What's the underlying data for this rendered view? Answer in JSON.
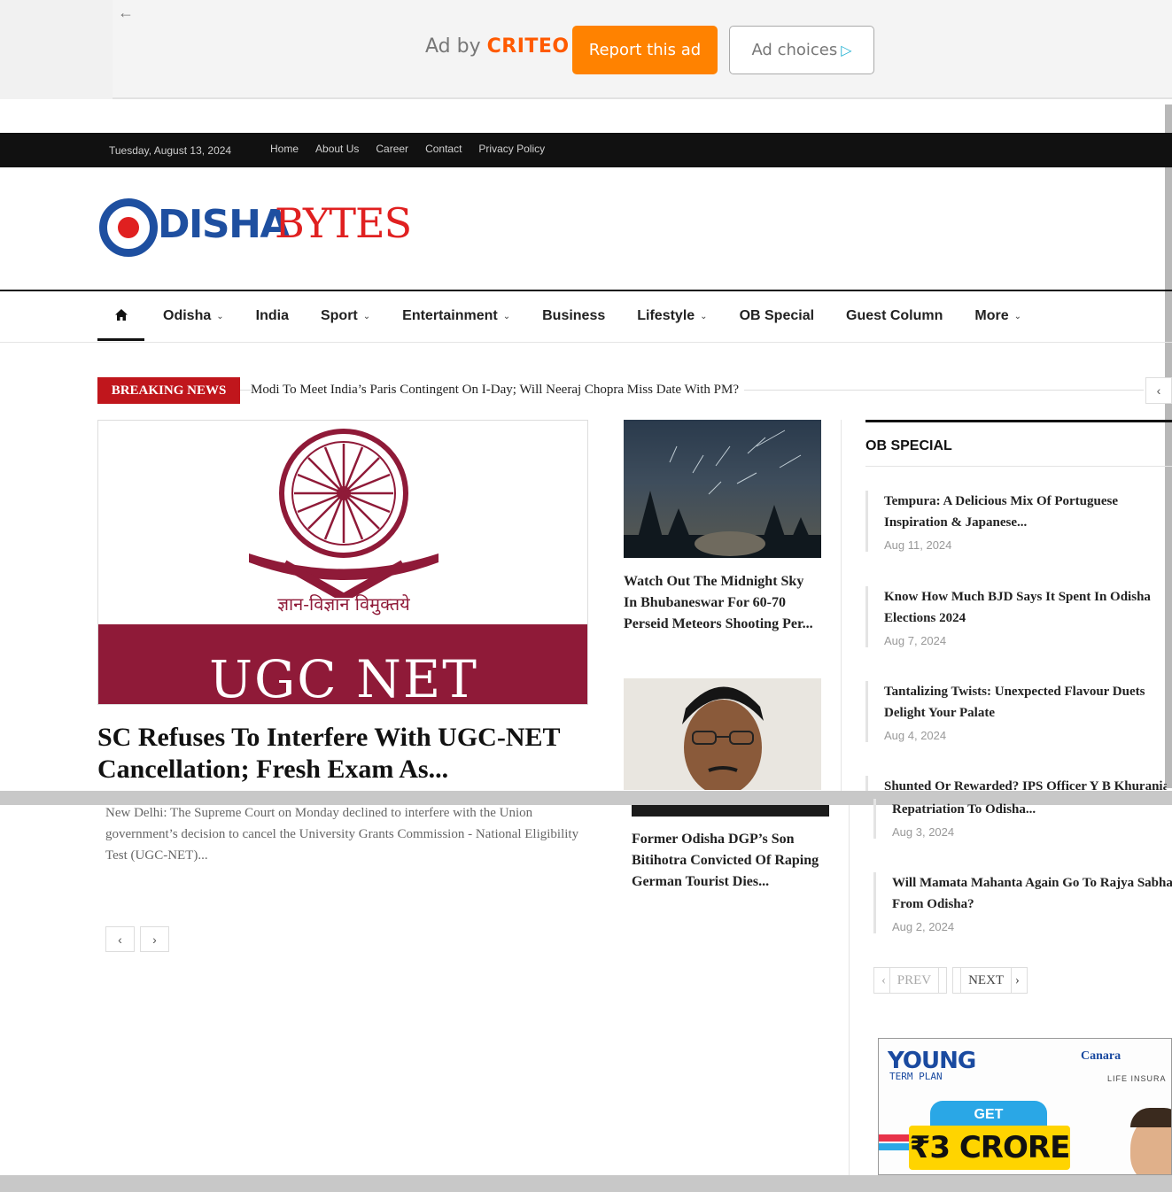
{
  "ad_bar": {
    "back_icon": "arrow-left-icon",
    "ad_by_prefix": "Ad by",
    "ad_by_brand": "CRITEO",
    "report_label": "Report this ad",
    "choices_label": "Ad choices",
    "choices_icon": "ad-choices-triangle-icon",
    "report_color": "#ff8200"
  },
  "topbar": {
    "date": "Tuesday, August 13, 2024",
    "links": [
      "Home",
      "About Us",
      "Career",
      "Contact",
      "Privacy Policy"
    ]
  },
  "logo": {
    "part1": "DISHA",
    "part2": "BYTES",
    "colors": {
      "blue": "#1e4fa0",
      "red": "#e02020"
    }
  },
  "mainnav": {
    "home_icon": "home-icon",
    "items": [
      {
        "label": "Odisha",
        "has_dropdown": true
      },
      {
        "label": "India",
        "has_dropdown": false
      },
      {
        "label": "Sport",
        "has_dropdown": true
      },
      {
        "label": "Entertainment",
        "has_dropdown": true
      },
      {
        "label": "Business",
        "has_dropdown": false
      },
      {
        "label": "Lifestyle",
        "has_dropdown": true
      },
      {
        "label": "OB Special",
        "has_dropdown": false
      },
      {
        "label": "Guest Column",
        "has_dropdown": false
      },
      {
        "label": "More",
        "has_dropdown": true
      }
    ]
  },
  "breaking": {
    "label": "BREAKING NEWS",
    "headline": "Modi To Meet India’s Paris Contingent On I-Day; Will Neeraj Chopra Miss Date With PM?",
    "label_color": "#c0161c"
  },
  "featured": {
    "image_hindi": "ज्ञान-विज्ञान विमुक्तये",
    "image_caption": "UGC NET",
    "title": "SC Refuses To Interfere With UGC-NET Cancellation; Fresh Exam As...",
    "excerpt": "New Delhi: The Supreme Court on Monday declined to interfere with the Union government’s decision to cancel the University Grants Commission - National Eligibility Test (UGC-NET)..."
  },
  "middle": {
    "story1": "Watch Out The Midnight Sky In Bhubaneswar For 60-70 Perseid Meteors Shooting Per...",
    "story2": "Former Odisha DGP’s Son Bitihotra Convicted Of Raping German Tourist Dies..."
  },
  "sidebar": {
    "heading": "OB SPECIAL",
    "items": [
      {
        "title_line1": "Tempura: A Delicious Mix Of Portuguese",
        "title_line2": "Inspiration & Japanese...",
        "date": "Aug 11, 2024"
      },
      {
        "title_line1": "Know How Much BJD Says It Spent In Odisha",
        "title_line2": "Elections 2024",
        "date": "Aug 7, 2024"
      },
      {
        "title_line1": "Tantalizing Twists: Unexpected Flavour Duets",
        "title_line2": "Delight Your Palate",
        "date": "Aug 4, 2024"
      },
      {
        "title_line1": "Shunted Or Rewarded? IPS Officer Y B Khurania",
        "title_line2": "Repatriation To Odisha...",
        "date": "Aug 3, 2024"
      },
      {
        "title_line1": "Will Mamata Mahanta Again Go To Rajya Sabha",
        "title_line2": "From Odisha?",
        "date": "Aug 2, 2024"
      }
    ],
    "prev_label": "PREV",
    "next_label": "NEXT"
  },
  "side_ad": {
    "young": "YOUNG",
    "term": "TERM PLAN",
    "brand": "Canara",
    "brand_sub": "LIFE INSURA",
    "get": "GET",
    "amount": "₹3 CRORE"
  }
}
